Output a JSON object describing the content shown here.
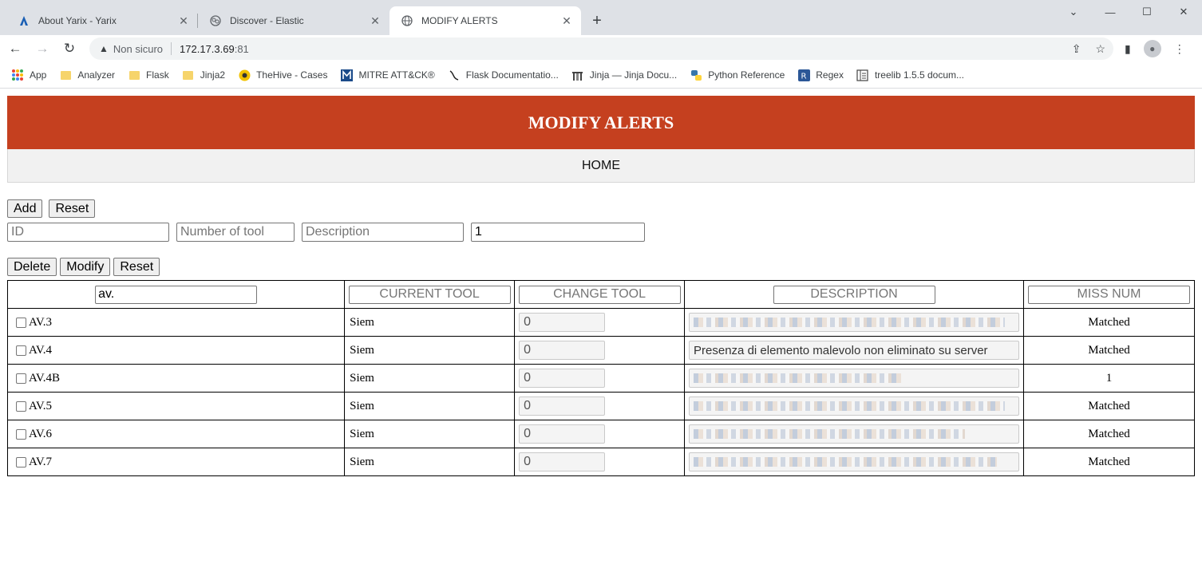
{
  "browser": {
    "tabs": [
      {
        "title": "About Yarix - Yarix",
        "icon": "yarix-logo-icon"
      },
      {
        "title": "Discover - Elastic",
        "icon": "elastic-logo-icon"
      },
      {
        "title": "MODIFY ALERTS",
        "icon": "globe-icon",
        "active": true
      }
    ],
    "address": {
      "security": "Non sicuro",
      "host": "172.17.3.69",
      "port": ":81"
    },
    "bookmarks": [
      {
        "label": "App",
        "icon": "apps-grid-icon"
      },
      {
        "label": "Analyzer",
        "icon": "folder-icon"
      },
      {
        "label": "Flask",
        "icon": "folder-icon"
      },
      {
        "label": "Jinja2",
        "icon": "folder-icon"
      },
      {
        "label": "TheHive - Cases",
        "icon": "thehive-icon"
      },
      {
        "label": "MITRE ATT&CK®",
        "icon": "mitre-icon"
      },
      {
        "label": "Flask Documentatio...",
        "icon": "flask-icon"
      },
      {
        "label": "Jinja — Jinja Docu...",
        "icon": "jinja-icon"
      },
      {
        "label": "Python Reference",
        "icon": "python-icon"
      },
      {
        "label": "Regex",
        "icon": "regex-icon"
      },
      {
        "label": "treelib 1.5.5 docum...",
        "icon": "treelib-icon"
      }
    ]
  },
  "page": {
    "header": "MODIFY ALERTS",
    "nav_home": "HOME",
    "add_form": {
      "add_label": "Add",
      "reset_label": "Reset",
      "id_placeholder": "ID",
      "tool_placeholder": "Number of tool",
      "desc_placeholder": "Description",
      "fourth_value": "1"
    },
    "actions": {
      "delete_label": "Delete",
      "modify_label": "Modify",
      "reset_label": "Reset"
    },
    "table": {
      "filter_value": "av.",
      "headers": {
        "current_tool": "CURRENT TOOL",
        "change_tool": "CHANGE TOOL",
        "description": "DESCRIPTION",
        "miss_num": "MISS NUM"
      },
      "rows": [
        {
          "id": "AV.3",
          "tool": "Siem",
          "change": "0",
          "description": "",
          "miss": "Matched"
        },
        {
          "id": "AV.4",
          "tool": "Siem",
          "change": "0",
          "description": "Presenza di elemento malevolo non eliminato su server",
          "miss": "Matched"
        },
        {
          "id": "AV.4B",
          "tool": "Siem",
          "change": "0",
          "description": "",
          "miss": "1"
        },
        {
          "id": "AV.5",
          "tool": "Siem",
          "change": "0",
          "description": "",
          "miss": "Matched"
        },
        {
          "id": "AV.6",
          "tool": "Siem",
          "change": "0",
          "description": "",
          "miss": "Matched"
        },
        {
          "id": "AV.7",
          "tool": "Siem",
          "change": "0",
          "description": "",
          "miss": "Matched"
        }
      ]
    }
  }
}
